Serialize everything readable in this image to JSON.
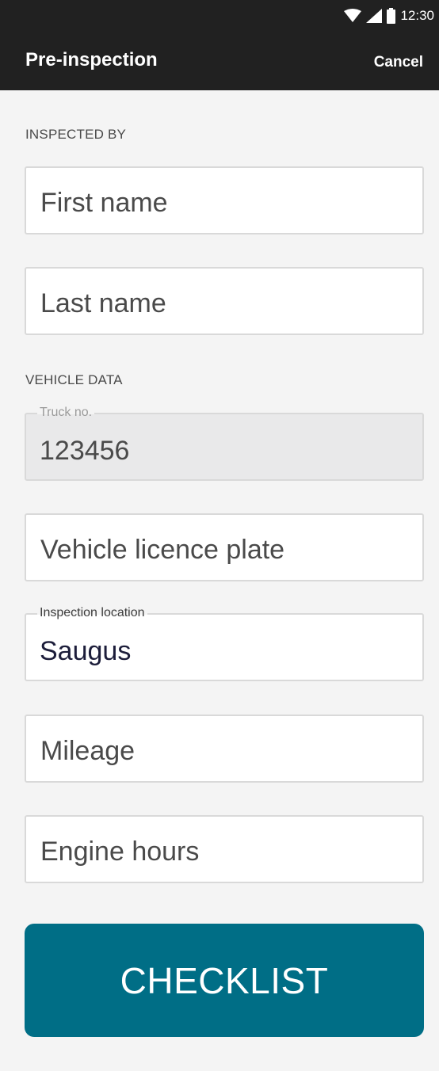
{
  "status_bar": {
    "time": "12:30",
    "icons": [
      "wifi-icon",
      "signal-icon",
      "battery-icon"
    ]
  },
  "app_bar": {
    "title": "Pre-inspection",
    "cancel_label": "Cancel"
  },
  "sections": {
    "inspected_by": "INSPECTED BY",
    "vehicle_data": "VEHICLE DATA"
  },
  "fields": {
    "first_name": {
      "placeholder": "First name",
      "value": ""
    },
    "last_name": {
      "placeholder": "Last name",
      "value": ""
    },
    "truck_no": {
      "label": "Truck no.",
      "value": "123456",
      "disabled": true
    },
    "licence_plate": {
      "placeholder": "Vehicle licence plate",
      "value": ""
    },
    "inspection_location": {
      "label": "Inspection location",
      "value": "Saugus"
    },
    "mileage": {
      "placeholder": "Mileage",
      "value": ""
    },
    "engine_hours": {
      "placeholder": "Engine hours",
      "value": ""
    }
  },
  "checklist_button": {
    "label": "CHECKLIST"
  },
  "colors": {
    "app_bar": "#212121",
    "background": "#f4f4f4",
    "primary_button": "#006e86",
    "field_border": "#d9d9d9",
    "disabled_field": "#e9e9ea"
  }
}
